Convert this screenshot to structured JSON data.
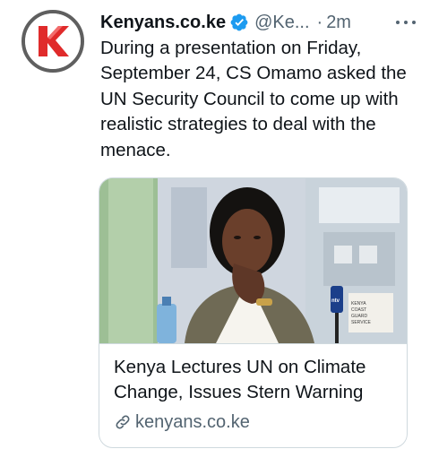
{
  "tweet": {
    "author_name": "Kenyans.co.ke",
    "author_handle": "@Ke...",
    "separator": "·",
    "time_ago": "2m",
    "text": "During a presentation on Friday, September 24, CS Omamo asked the UN Security Council to come up with realistic strategies to deal with the menace.",
    "verified": true
  },
  "card": {
    "title": "Kenya Lectures UN on Climate Change, Issues Stern Warning",
    "domain": "kenyans.co.ke",
    "image_sign_text": "KENYA COAST GUARD SERVICE",
    "image_logo_text": "ntv"
  },
  "icons": {
    "avatar": "kenyans-k-logo",
    "verified": "verified-badge-icon",
    "more": "more-dots-icon",
    "link": "link-icon"
  },
  "colors": {
    "brand_red": "#e02b2b",
    "verified_blue": "#1d9bf0",
    "secondary_text": "#536471",
    "border": "#cfd9de"
  }
}
